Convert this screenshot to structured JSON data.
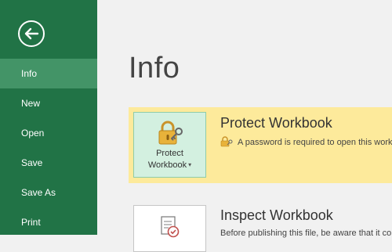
{
  "sidebar": {
    "items": [
      {
        "label": "Info",
        "active": true
      },
      {
        "label": "New"
      },
      {
        "label": "Open"
      },
      {
        "label": "Save"
      },
      {
        "label": "Save As"
      },
      {
        "label": "Print"
      }
    ]
  },
  "main": {
    "title": "Info",
    "protect": {
      "button_line1": "Protect",
      "button_line2": "Workbook",
      "heading": "Protect Workbook",
      "description": "A password is required to open this workbook."
    },
    "inspect": {
      "heading": "Inspect Workbook",
      "description": "Before publishing this file, be aware that it contains:"
    }
  },
  "icons": {
    "back": "back-arrow-icon",
    "lock": "lock-key-icon",
    "small_lock": "small-lock-icon",
    "inspect": "document-check-icon"
  },
  "colors": {
    "sidebar": "#217346",
    "sidebar_active": "#439467",
    "highlight": "#fdea9b",
    "button_active": "#d3f0e0"
  }
}
